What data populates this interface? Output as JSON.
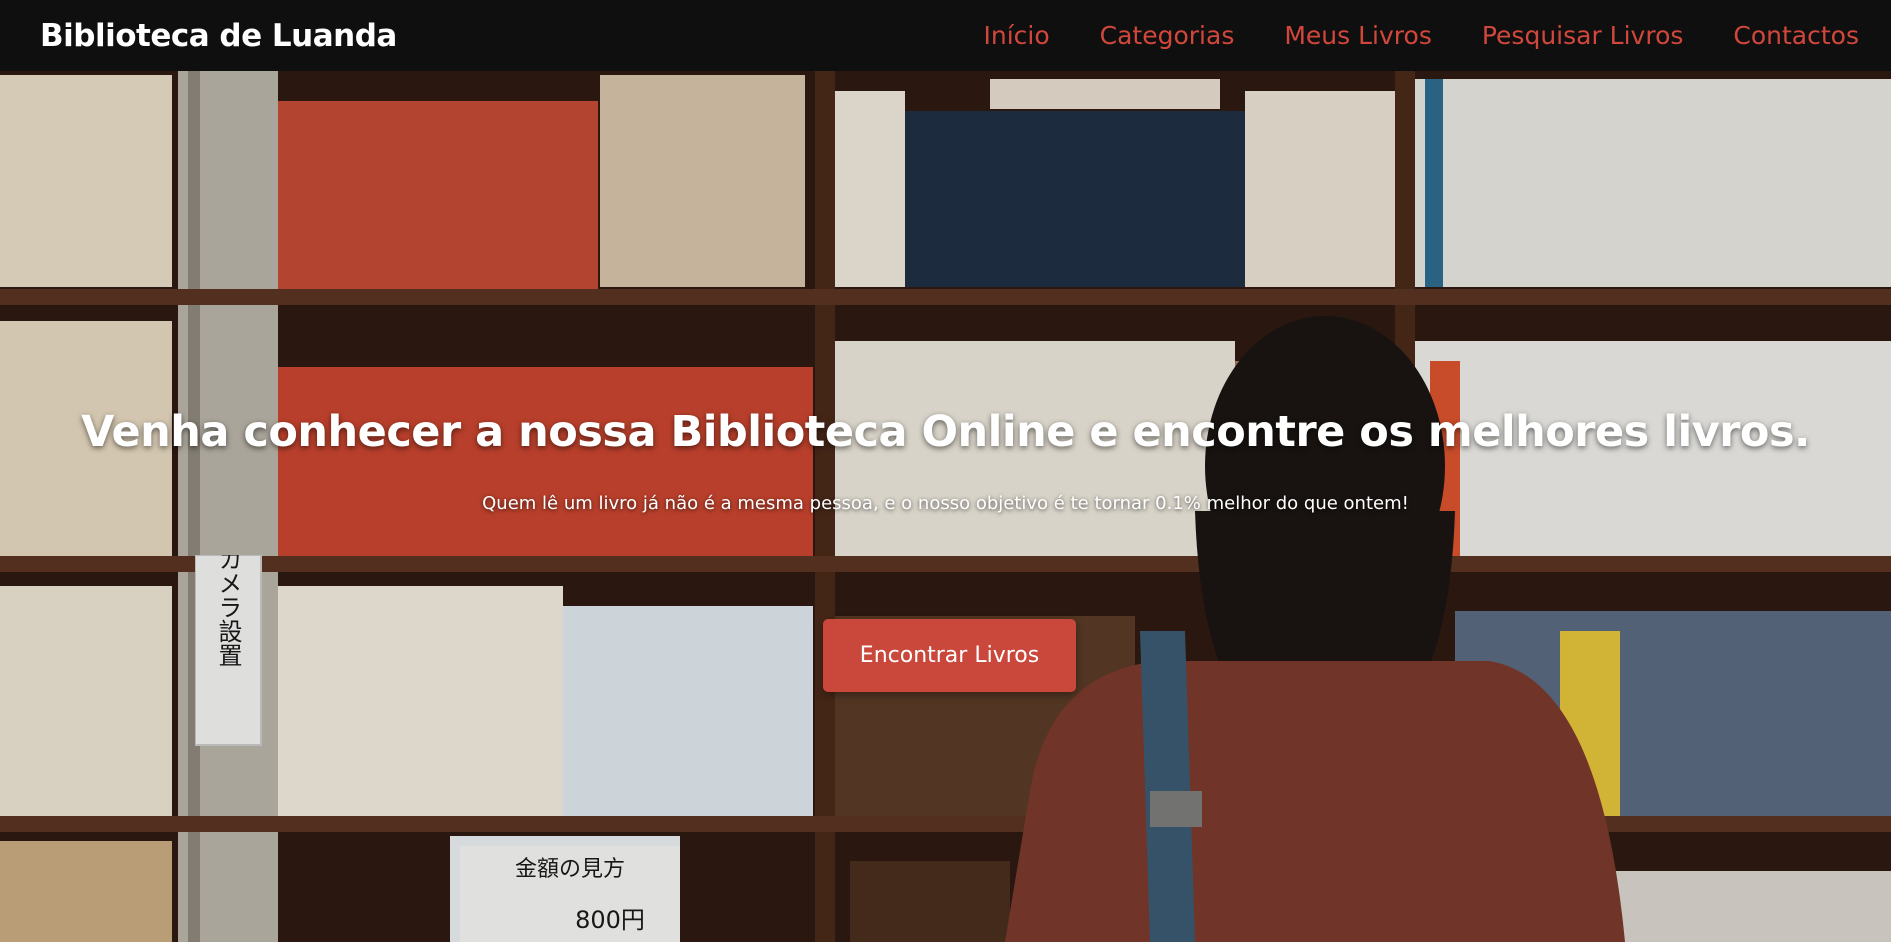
{
  "nav": {
    "brand": "Biblioteca de Luanda",
    "links": [
      {
        "label": "Início"
      },
      {
        "label": "Categorias"
      },
      {
        "label": "Meus Livros"
      },
      {
        "label": "Pesquisar Livros"
      },
      {
        "label": "Contactos"
      }
    ]
  },
  "hero": {
    "title": "Venha conhecer a nossa Biblioteca Online e encontre os melhores livros.",
    "subtitle": "Quem lê um livro já não é a mesma pessoa, e o nosso objetivo é te tornar 0.1% melhor do que ontem!",
    "cta_label": "Encontrar Livros",
    "sign_top": "防犯カメラ設置",
    "sign_bottom": "金額の見方",
    "sign_price": "800円"
  },
  "colors": {
    "accent": "#c9473b",
    "nav_bg": "#0f0f10"
  }
}
